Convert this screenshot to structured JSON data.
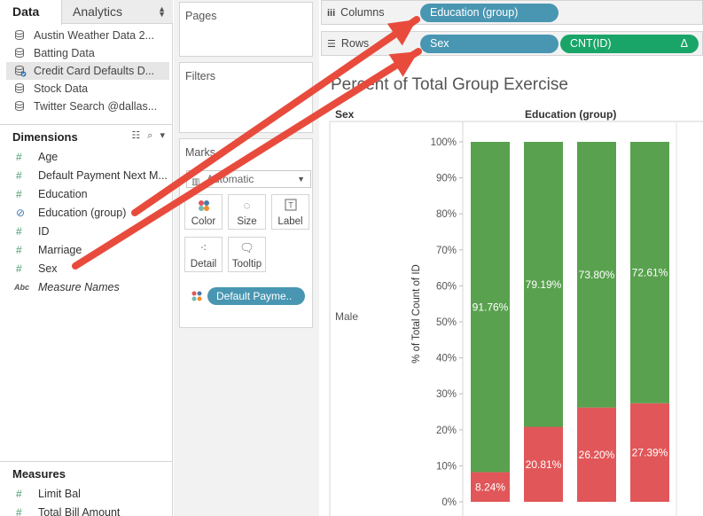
{
  "tabs": {
    "data": "Data",
    "analytics": "Analytics"
  },
  "datasources": [
    {
      "label": "Austin Weather Data 2...",
      "selected": false
    },
    {
      "label": "Batting Data",
      "selected": false
    },
    {
      "label": "Credit Card Defaults D...",
      "selected": true
    },
    {
      "label": "Stock Data",
      "selected": false
    },
    {
      "label": "Twitter Search @dallas...",
      "selected": false
    }
  ],
  "dimensions": {
    "title": "Dimensions",
    "fields": [
      {
        "label": "Age",
        "icon": "hash-icon"
      },
      {
        "label": "Default Payment Next M...",
        "icon": "hash-icon"
      },
      {
        "label": "Education",
        "icon": "hash-icon"
      },
      {
        "label": "Education (group)",
        "icon": "paperclip-icon"
      },
      {
        "label": "ID",
        "icon": "hash-icon"
      },
      {
        "label": "Marriage",
        "icon": "hash-icon"
      },
      {
        "label": "Sex",
        "icon": "hash-icon"
      },
      {
        "label": "Measure Names",
        "icon": "abc-icon"
      }
    ]
  },
  "measures": {
    "title": "Measures",
    "fields": [
      {
        "label": "Limit Bal",
        "icon": "hash-icon"
      },
      {
        "label": "Total Bill Amount",
        "icon": "hash-icon"
      }
    ]
  },
  "cards": {
    "pages": "Pages",
    "filters": "Filters",
    "marks": "Marks",
    "marks_type": "Automatic",
    "buttons": {
      "color": "Color",
      "size": "Size",
      "label": "Label",
      "detail": "Detail",
      "tooltip": "Tooltip"
    },
    "color_pill": "Default Payme.."
  },
  "shelves": {
    "columns_label": "Columns",
    "rows_label": "Rows",
    "columns_pill": "Education (group)",
    "rows_pill_1": "Sex",
    "rows_pill_2": "CNT(ID)",
    "rows_pill_2_badge": "Δ"
  },
  "view": {
    "title": "Percent of Total Group Exercise",
    "row_header": "Sex",
    "column_header": "Education (group)",
    "row_value": "Male",
    "y_axis_title": "% of Total Count of ID"
  },
  "colors": {
    "green": "#59a14f",
    "red": "#e15759",
    "pill_blue": "#4996b2",
    "pill_green": "#1aa568",
    "arrow": "#e84b3c"
  },
  "chart_data": {
    "type": "bar",
    "stacked": true,
    "categories": [
      "",
      "",
      "",
      ""
    ],
    "series": [
      {
        "values": [
          8.24,
          20.81,
          26.2,
          27.39
        ],
        "labels": [
          "8.24%",
          "20.81%",
          "26.20%",
          "27.39%"
        ],
        "color": "#e15759"
      },
      {
        "values": [
          91.76,
          79.19,
          73.8,
          72.61
        ],
        "labels": [
          "91.76%",
          "79.19%",
          "73.80%",
          "72.61%"
        ],
        "color": "#59a14f"
      }
    ],
    "ylabel": "% of Total Count of ID",
    "yticks": [
      "0%",
      "10%",
      "20%",
      "30%",
      "40%",
      "50%",
      "60%",
      "70%",
      "80%",
      "90%",
      "100%"
    ],
    "ylim": [
      0,
      100
    ]
  }
}
